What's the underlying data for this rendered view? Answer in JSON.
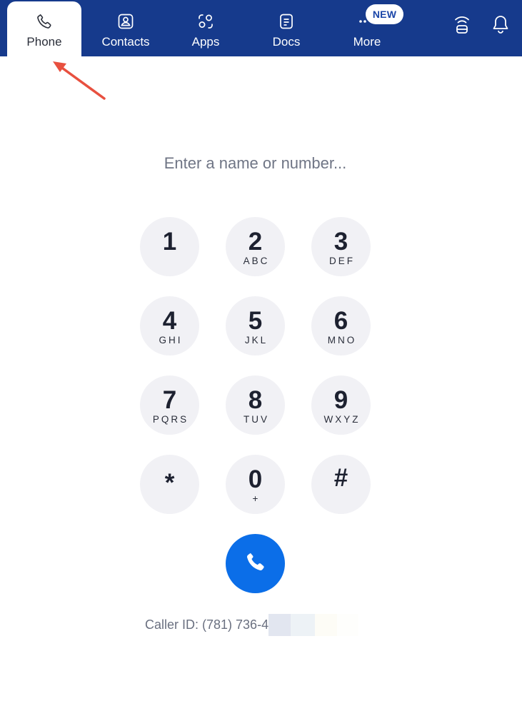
{
  "colors": {
    "nav_bg": "#163a8c",
    "call_button": "#0b6ee8",
    "key_bg": "#f1f1f5",
    "annotation": "#e8503f"
  },
  "nav": {
    "tabs": [
      {
        "label": "Phone",
        "icon": "phone-icon",
        "active": true
      },
      {
        "label": "Contacts",
        "icon": "contact-card-icon",
        "active": false
      },
      {
        "label": "Apps",
        "icon": "apps-icon",
        "active": false
      },
      {
        "label": "Docs",
        "icon": "document-icon",
        "active": false
      },
      {
        "label": "More",
        "icon": "more-dots-icon",
        "active": false
      }
    ],
    "new_badge": "NEW",
    "right_icons": [
      "wireless-icon",
      "bell-icon"
    ]
  },
  "dialer": {
    "placeholder": "Enter a name or number...",
    "keys": [
      {
        "digit": "1",
        "letters": ""
      },
      {
        "digit": "2",
        "letters": "ABC"
      },
      {
        "digit": "3",
        "letters": "DEF"
      },
      {
        "digit": "4",
        "letters": "GHI"
      },
      {
        "digit": "5",
        "letters": "JKL"
      },
      {
        "digit": "6",
        "letters": "MNO"
      },
      {
        "digit": "7",
        "letters": "PQRS"
      },
      {
        "digit": "8",
        "letters": "TUV"
      },
      {
        "digit": "9",
        "letters": "WXYZ"
      },
      {
        "digit": "*",
        "letters": ""
      },
      {
        "digit": "0",
        "letters": "+"
      },
      {
        "digit": "#",
        "letters": ""
      }
    ],
    "call_icon": "phone-icon",
    "caller_id": "Caller ID: (781) 736-4"
  }
}
